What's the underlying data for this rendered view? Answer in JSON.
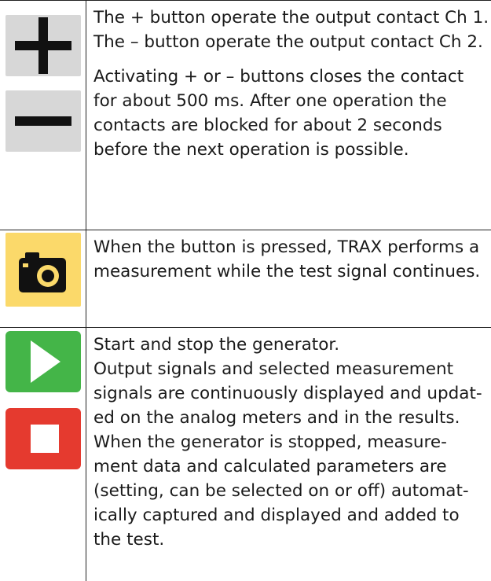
{
  "rows": [
    {
      "icons": [
        "plus-icon",
        "minus-icon"
      ],
      "lines": [
        "The + button operate the output contact Ch 1.",
        "The – button operate the output contact Ch 2."
      ],
      "note": "Activating + or – buttons closes the contact for about 500 ms. After one operation the contacts are blocked for about 2 seconds before the next operation is possible."
    },
    {
      "icons": [
        "camera-icon"
      ],
      "text": "When the button is pressed, TRAX performs a measurement while the test signal continues."
    },
    {
      "icons": [
        "play-icon",
        "stop-icon"
      ],
      "lines": [
        "Start and stop the generator.",
        "Output signals and selected measurement signals are continuously displayed and updat-ed on the analog meters and in the results. When the generator is stopped, measure-ment data and calculated parameters are (setting, can be selected on or off) automat-ically captured and displayed and added to the test."
      ]
    }
  ],
  "colors": {
    "icon_gray": "#d7d7d7",
    "icon_yellow": "#fbd96a",
    "play_green": "#44b548",
    "stop_red": "#e53a2f"
  }
}
